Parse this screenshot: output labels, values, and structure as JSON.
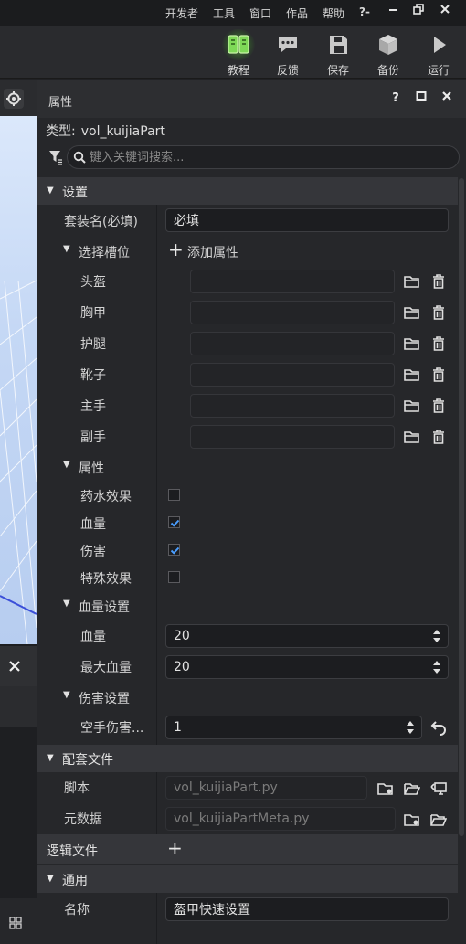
{
  "menu": {
    "items": [
      "开发者",
      "工具",
      "窗口",
      "作品",
      "帮助"
    ],
    "help_glyph": "?-"
  },
  "toolbar": {
    "tools": [
      {
        "label": "教程",
        "icon": "book-icon",
        "active": true
      },
      {
        "label": "反馈",
        "icon": "chat-bubble-icon"
      },
      {
        "label": "保存",
        "icon": "save-icon"
      },
      {
        "label": "备份",
        "icon": "cube-icon"
      },
      {
        "label": "运行",
        "icon": "play-icon"
      }
    ]
  },
  "panel": {
    "title": "属性",
    "type_label": "类型:",
    "type_value": "vol_kuijiaPart",
    "search_placeholder": "键入关键词搜索..."
  },
  "settings": {
    "section": "设置",
    "suit_name_label": "套装名(必填)",
    "suit_name_value": "必填",
    "slots_label": "选择槽位",
    "add_property": "添加属性",
    "slots": [
      "头盔",
      "胸甲",
      "护腿",
      "靴子",
      "主手",
      "副手"
    ],
    "attrs_label": "属性",
    "attrs": [
      {
        "label": "药水效果",
        "checked": false
      },
      {
        "label": "血量",
        "checked": true
      },
      {
        "label": "伤害",
        "checked": true
      },
      {
        "label": "特殊效果",
        "checked": false
      }
    ],
    "hp_settings_label": "血量设置",
    "hp_label": "血量",
    "hp_value": "20",
    "max_hp_label": "最大血量",
    "max_hp_value": "20",
    "dmg_settings_label": "伤害设置",
    "fist_dmg_label": "空手伤害...",
    "fist_dmg_value": "1"
  },
  "files": {
    "section": "配套文件",
    "script_label": "脚本",
    "script_value": "vol_kuijiaPart.py",
    "meta_label": "元数据",
    "meta_value": "vol_kuijiaPartMeta.py"
  },
  "logic": {
    "section": "逻辑文件"
  },
  "general": {
    "section": "通用",
    "name_label": "名称",
    "name_value": "盔甲快速设置"
  },
  "colors": {
    "accent": "#4a9eff",
    "active_tool": "#6fcf3e",
    "panel_bg": "#26272a",
    "section_bg": "#35363a"
  }
}
